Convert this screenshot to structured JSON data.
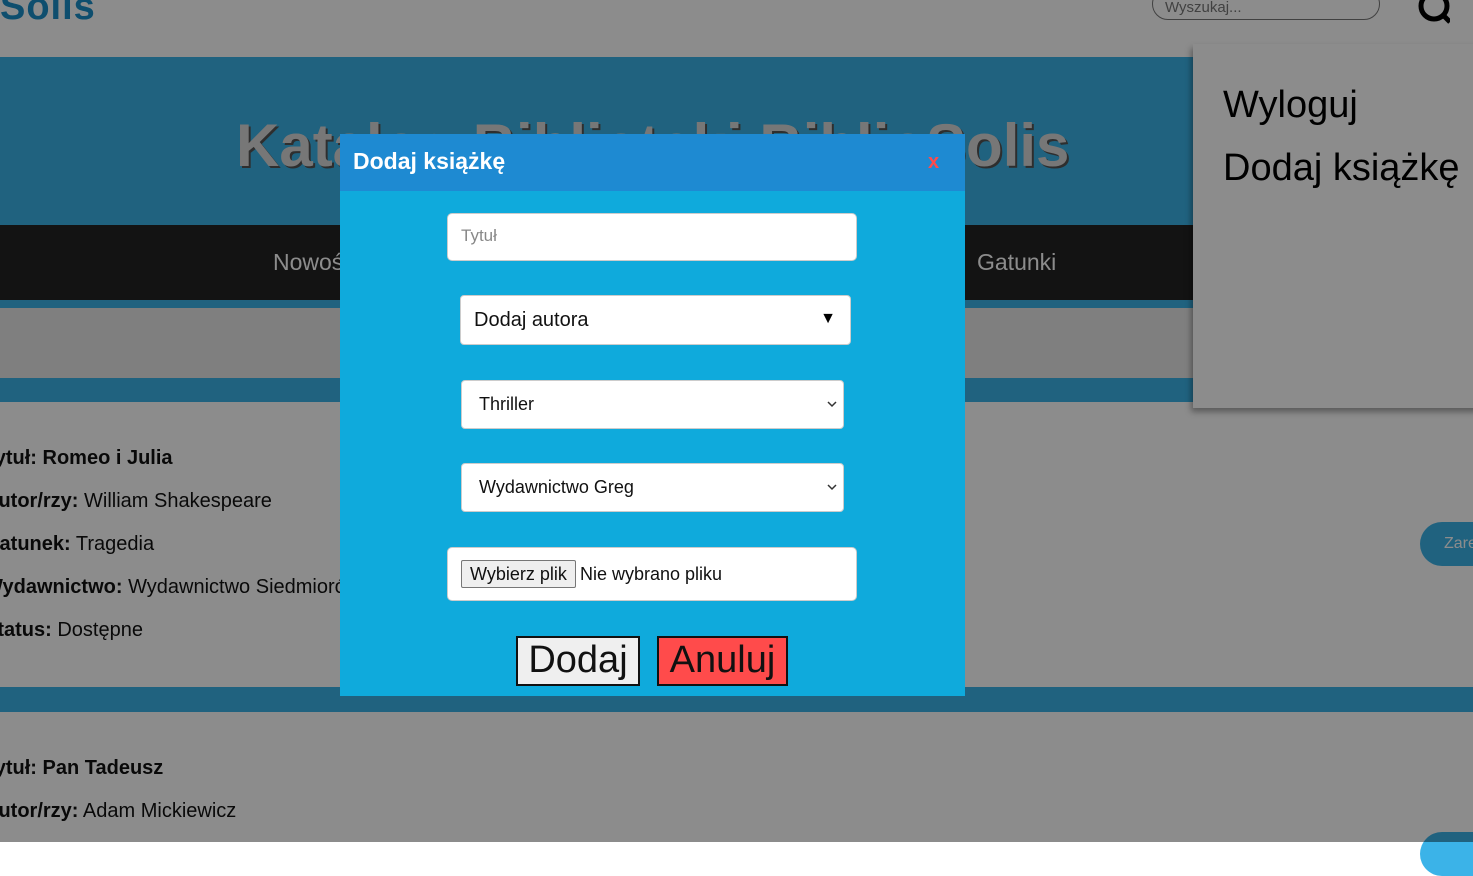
{
  "header": {
    "logo": "Solis",
    "search_placeholder": "Wyszukaj..."
  },
  "hero": {
    "title": "Katalog Biblioteki BiblioSolis"
  },
  "nav": {
    "items": [
      {
        "label": "Nowości"
      },
      {
        "label": "Gatunki"
      }
    ]
  },
  "books": [
    {
      "title_label": "Tytuł:",
      "title": "Romeo i Julia",
      "author_label": "Autor/rzy:",
      "author": "William Shakespeare",
      "genre_label": "Gatunek:",
      "genre": "Tragedia",
      "publisher_label": "Wydawnictwo:",
      "publisher": "Wydawnictwo Siedmioróg",
      "status_label": "Status:",
      "status": "Dostępne",
      "reserve_label": "Zarezerwuj"
    },
    {
      "title_label": "Tytuł:",
      "title": "Pan Tadeusz",
      "author_label": "Autor/rzy:",
      "author": "Adam Mickiewicz"
    }
  ],
  "side_menu": {
    "items": [
      {
        "label": "Wyloguj"
      },
      {
        "label": "Dodaj książkę"
      }
    ]
  },
  "modal": {
    "title": "Dodaj książkę",
    "close_label": "x",
    "title_placeholder": "Tytuł",
    "author_select": "Dodaj autora",
    "genre_select": "Thriller",
    "publisher_select": "Wydawnictwo Greg",
    "file_button": "Wybierz plik",
    "file_status": "Nie wybrano pliku",
    "submit_label": "Dodaj",
    "cancel_label": "Anuluj"
  },
  "colors": {
    "accent": "#3bb3e8",
    "modal_body": "#0faadc",
    "modal_header": "#1e8ad2",
    "cancel": "#ff4b4b",
    "nav": "#232323"
  }
}
